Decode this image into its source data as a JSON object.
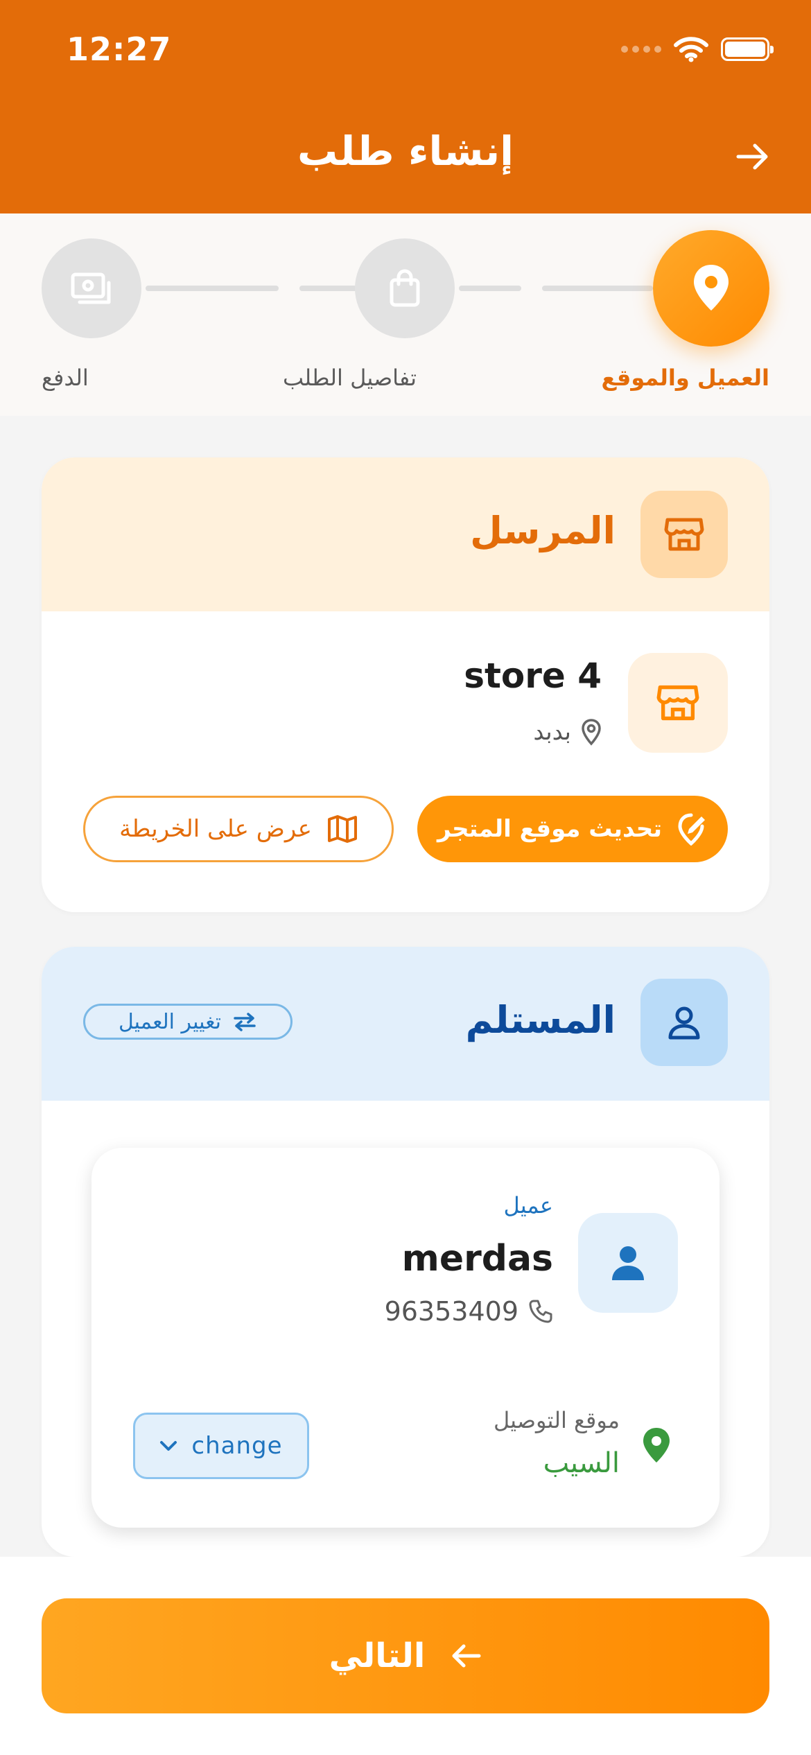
{
  "status": {
    "time": "12:27"
  },
  "header": {
    "title": "إنشاء طلب"
  },
  "stepper": {
    "steps": [
      {
        "label": "العميل والموقع",
        "active": true
      },
      {
        "label": "تفاصيل الطلب",
        "active": false
      },
      {
        "label": "الدفع",
        "active": false
      }
    ]
  },
  "sender": {
    "title": "المرسل",
    "store_name": "store 4",
    "store_location": "بدبد",
    "update_location_label": "تحديث موقع المتجر",
    "view_map_label": "عرض على الخريطة"
  },
  "receiver": {
    "title": "المستلم",
    "change_customer_label": "تغيير العميل",
    "customer": {
      "type_label": "عميل",
      "name": "merdas",
      "phone": "96353409",
      "delivery_location_label": "موقع التوصيل",
      "delivery_location": "السيب",
      "change_label": "change"
    }
  },
  "footer": {
    "next_label": "التالي"
  },
  "colors": {
    "brand_orange": "#e36c09",
    "accent_orange": "#ff9608",
    "sender_header_bg": "#fff1dc",
    "receiver_header_bg": "#e2effb",
    "receiver_title": "#0d4a9a",
    "success_green": "#3a9a3e"
  }
}
